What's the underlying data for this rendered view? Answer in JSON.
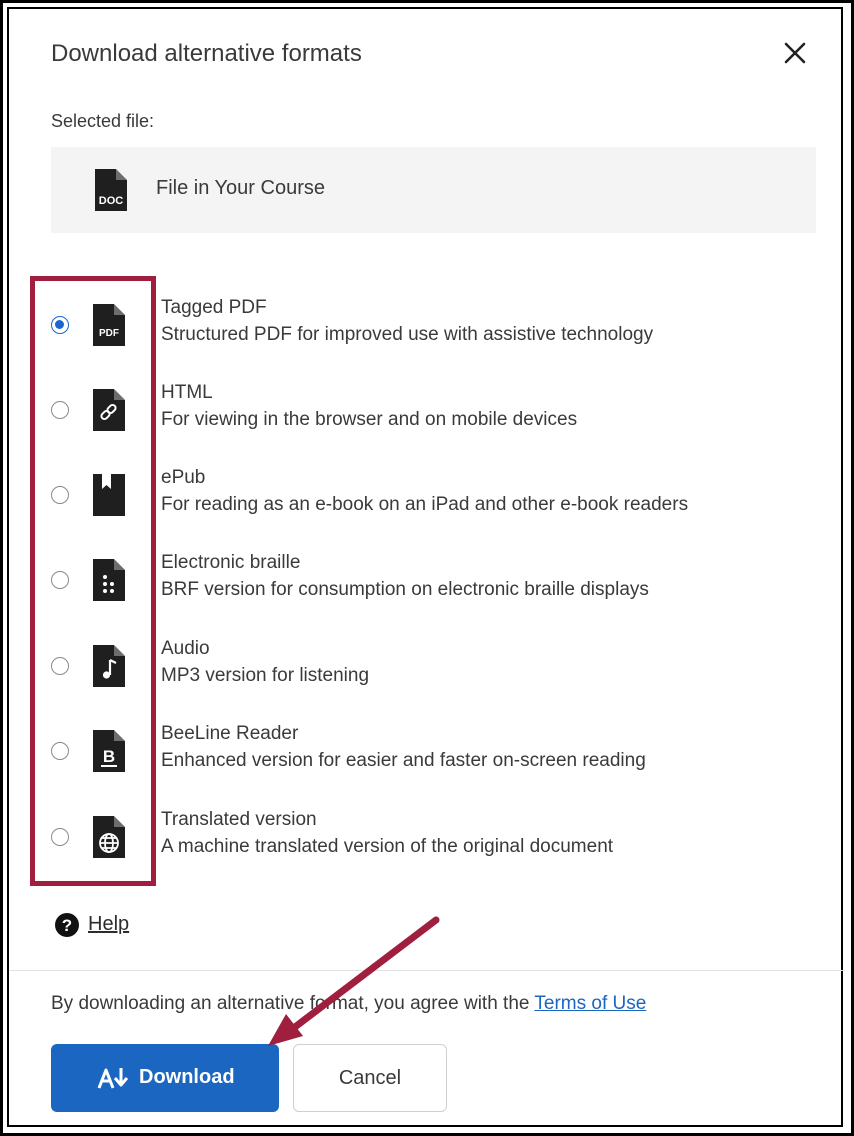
{
  "dialog": {
    "title": "Download alternative formats",
    "close_icon": "close-icon"
  },
  "selected_file": {
    "label": "Selected file:",
    "name": "File in Your Course",
    "icon": "doc-file-icon",
    "icon_text": "DOC"
  },
  "formats": [
    {
      "title": "Tagged PDF",
      "description": "Structured PDF for improved use with assistive technology",
      "icon": "pdf-file-icon",
      "icon_text": "PDF",
      "checked": true
    },
    {
      "title": "HTML",
      "description": "For viewing in the browser and on mobile devices",
      "icon": "link-file-icon",
      "checked": false
    },
    {
      "title": "ePub",
      "description": "For reading as an e-book on an iPad and other e-book readers",
      "icon": "bookmark-file-icon",
      "checked": false
    },
    {
      "title": "Electronic braille",
      "description": "BRF version for consumption on electronic braille displays",
      "icon": "braille-file-icon",
      "checked": false
    },
    {
      "title": "Audio",
      "description": "MP3 version for listening",
      "icon": "music-note-file-icon",
      "checked": false
    },
    {
      "title": "BeeLine Reader",
      "description": "Enhanced version for easier and faster on-screen reading",
      "icon": "beeline-file-icon",
      "icon_text": "B",
      "checked": false
    },
    {
      "title": "Translated version",
      "description": "A machine translated version of the original document",
      "icon": "globe-file-icon",
      "checked": false
    }
  ],
  "help": {
    "label": "Help",
    "icon": "question-circle-icon"
  },
  "terms": {
    "text": "By downloading an alternative format, you agree with the ",
    "link": "Terms of Use"
  },
  "buttons": {
    "download": "Download",
    "cancel": "Cancel"
  },
  "colors": {
    "accent": "#1a66c0",
    "highlight": "#a01e3e",
    "radio_checked": "#1a66d1"
  }
}
